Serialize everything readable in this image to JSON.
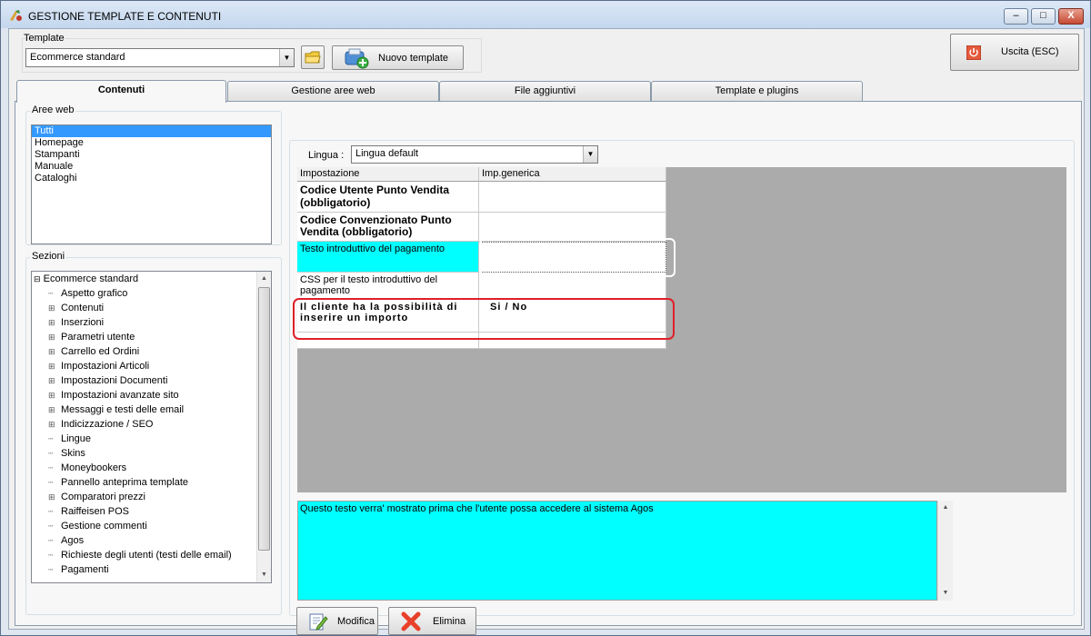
{
  "window": {
    "title": "GESTIONE TEMPLATE E CONTENUTI",
    "min_label": "‒",
    "max_label": "□",
    "close_label": "X"
  },
  "template": {
    "label": "Template",
    "selected": "Ecommerce standard",
    "new_button": "Nuovo template"
  },
  "exit_button": "Uscita (ESC)",
  "tabs": [
    {
      "label": "Contenuti"
    },
    {
      "label": "Gestione aree web"
    },
    {
      "label": "File aggiuntivi"
    },
    {
      "label": "Template e plugins"
    }
  ],
  "aree_web": {
    "label": "Aree web",
    "items": [
      "Tutti",
      "Homepage",
      "Stampanti",
      "Manuale",
      "Cataloghi"
    ]
  },
  "sezioni": {
    "label": "Sezioni",
    "root": "Ecommerce standard",
    "items": [
      {
        "label": "Aspetto grafico",
        "expandable": false
      },
      {
        "label": "Contenuti",
        "expandable": true
      },
      {
        "label": "Inserzioni",
        "expandable": true
      },
      {
        "label": "Parametri utente",
        "expandable": true
      },
      {
        "label": "Carrello ed Ordini",
        "expandable": true
      },
      {
        "label": "Impostazioni Articoli",
        "expandable": true
      },
      {
        "label": "Impostazioni Documenti",
        "expandable": true
      },
      {
        "label": "Impostazioni avanzate sito",
        "expandable": true
      },
      {
        "label": "Messaggi e testi delle email",
        "expandable": true
      },
      {
        "label": "Indicizzazione / SEO",
        "expandable": true
      },
      {
        "label": "Lingue",
        "expandable": false
      },
      {
        "label": "Skins",
        "expandable": false
      },
      {
        "label": "Moneybookers",
        "expandable": false
      },
      {
        "label": "Pannello anteprima template",
        "expandable": false
      },
      {
        "label": "Comparatori prezzi",
        "expandable": true
      },
      {
        "label": "Raiffeisen POS",
        "expandable": false
      },
      {
        "label": "Gestione commenti",
        "expandable": false
      },
      {
        "label": "Agos",
        "expandable": false
      },
      {
        "label": "Richieste degli utenti (testi delle email)",
        "expandable": false
      },
      {
        "label": "Pagamenti",
        "expandable": false
      }
    ]
  },
  "lingua": {
    "label": "Lingua :",
    "selected": "Lingua default"
  },
  "grid": {
    "headers": [
      "Impostazione",
      "Imp.generica"
    ],
    "rows": [
      {
        "setting": "Codice Utente Punto Vendita (obbligatorio)",
        "value": ""
      },
      {
        "setting": "Codice Convenzionato Punto Vendita (obbligatorio)",
        "value": ""
      },
      {
        "setting": "Testo introduttivo del pagamento",
        "value": ""
      },
      {
        "setting": "CSS per il testo introduttivo del pagamento",
        "value": ""
      },
      {
        "setting": "Il cliente ha la possibilità di inserire un importo",
        "value": "Si / No"
      }
    ]
  },
  "description": "Questo testo verra' mostrato prima che l'utente possa accedere al sistema Agos",
  "buttons": {
    "modify": "Modifica",
    "delete": "Elimina"
  },
  "colors": {
    "selected_cell": "#00ffff",
    "highlight_red": "#e0202a",
    "grid_background": "#ababab"
  }
}
